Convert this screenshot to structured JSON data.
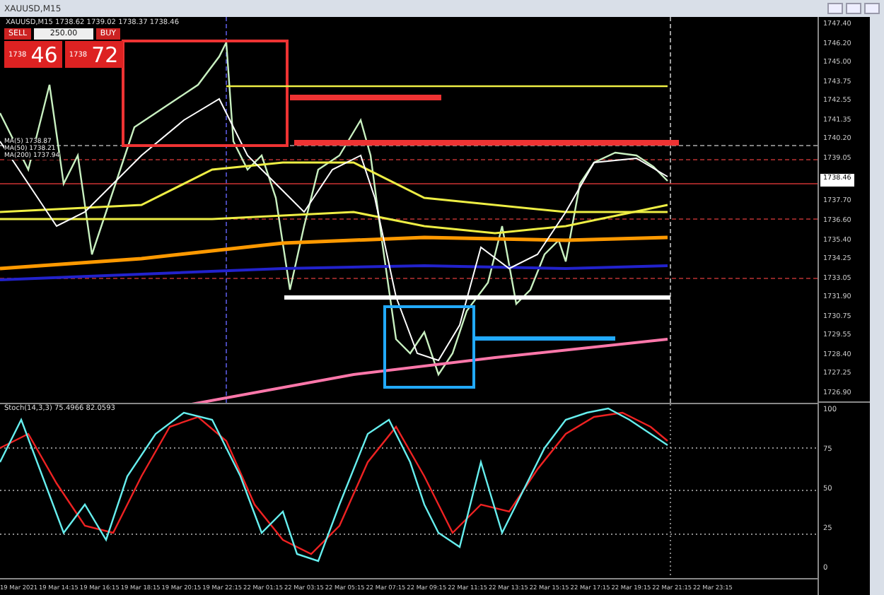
{
  "window": {
    "title": "XAUUSD,M15"
  },
  "chart_header": {
    "symbol_line": "XAUUSD,M15  1738.62 1739.02 1738.37 1738.46"
  },
  "trade_panel": {
    "sell_label": "SELL",
    "buy_label": "BUY",
    "volume": "250.00",
    "sell_price_small": "1738",
    "sell_price_big": "46",
    "buy_price_small": "1738",
    "buy_price_big": "72"
  },
  "indicator_labels": [
    "MA(5) 1738.87",
    "MA(50) 1738.21",
    "MA(200) 1737.94"
  ],
  "price_axis": [
    "1747.40",
    "1746.20",
    "1745.00",
    "1743.75",
    "1742.55",
    "1741.35",
    "1740.20",
    "1739.05",
    "1737.70",
    "1736.60",
    "1735.40",
    "1734.25",
    "1733.05",
    "1731.90",
    "1730.75",
    "1729.55",
    "1728.40",
    "1727.25",
    "1726.90"
  ],
  "current_price": "1738.46",
  "stochastic": {
    "label": "Stoch(14,3,3) 75.4966 82.0593",
    "levels": [
      "100",
      "75",
      "50",
      "25",
      "0"
    ]
  },
  "time_axis": [
    "19 Mar 2021",
    "19 Mar 14:15",
    "19 Mar 16:15",
    "19 Mar 18:15",
    "19 Mar 20:15",
    "19 Mar 22:15",
    "22 Mar 01:15",
    "22 Mar 03:15",
    "22 Mar 05:15",
    "22 Mar 07:15",
    "22 Mar 09:15",
    "22 Mar 11:15",
    "22 Mar 13:15",
    "22 Mar 15:15",
    "22 Mar 17:15",
    "22 Mar 19:15",
    "22 Mar 21:15",
    "22 Mar 23:15"
  ]
}
